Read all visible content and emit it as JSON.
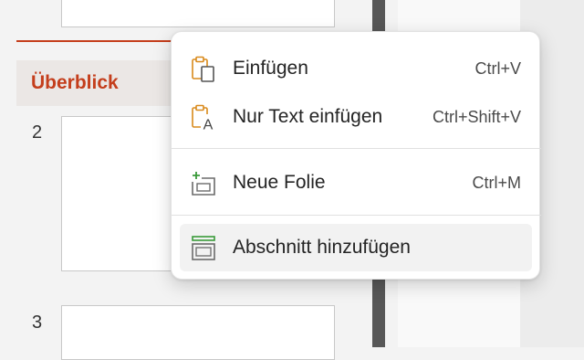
{
  "thumbnail_pane": {
    "section_title": "Überblick",
    "slides": [
      {
        "number": "2"
      },
      {
        "number": "3"
      }
    ]
  },
  "context_menu": {
    "items": [
      {
        "label": "Einfügen",
        "shortcut": "Ctrl+V",
        "icon": "paste-icon"
      },
      {
        "label": "Nur Text einfügen",
        "shortcut": "Ctrl+Shift+V",
        "icon": "paste-text-only-icon"
      },
      {
        "label": "Neue Folie",
        "shortcut": "Ctrl+M",
        "icon": "new-slide-icon"
      },
      {
        "label": "Abschnitt hinzufügen",
        "shortcut": "",
        "icon": "add-section-icon"
      }
    ]
  },
  "colors": {
    "accent": "#c43e1c",
    "icon_orange": "#d98a1c",
    "icon_green": "#3a9a3a",
    "icon_gray": "#6b6b6b",
    "menu_hover": "#f2f2f2"
  }
}
